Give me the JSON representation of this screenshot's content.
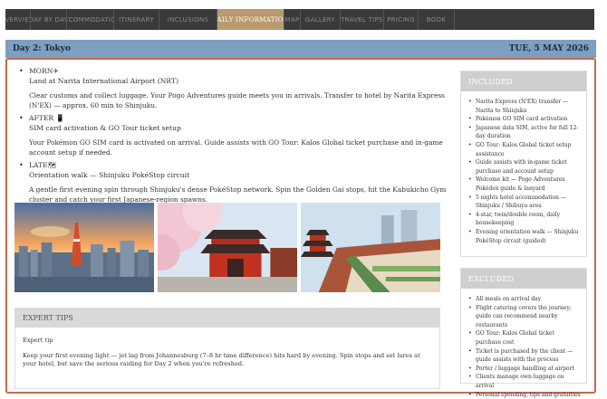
{
  "nav": {
    "tabs": [
      {
        "label": "OVERVIEW",
        "active": false
      },
      {
        "label": "DAY BY DAY",
        "active": false
      },
      {
        "label": "ACCOMMODATION",
        "active": false
      },
      {
        "label": "ITINERARY",
        "active": false
      },
      {
        "label": "INCLUSIONS",
        "active": false
      },
      {
        "label": "DAILY INFORMATION",
        "active": true
      },
      {
        "label": "MAP",
        "active": false
      },
      {
        "label": "GALLERY",
        "active": false
      },
      {
        "label": "TRAVEL TIPS",
        "active": false
      },
      {
        "label": "PRICING",
        "active": false
      },
      {
        "label": "BOOK",
        "active": false
      }
    ]
  },
  "day": {
    "title": "Day 2: Tokyo",
    "date": "TUE, 5 MAY 2026"
  },
  "schedule": [
    {
      "slot": "MORN✈",
      "title": "Land at Narita International Airport (NRT)",
      "description": "Clear customs and collect luggage. Your Pogo Adventures guide meets you in arrivals. Transfer to hotel by Narita Express (N'EX) — approx. 60 min to Shinjuku."
    },
    {
      "slot": "AFTER 📱",
      "title": "SIM card activation & GO Tour ticket setup",
      "description": "Your Pokémon GO SIM card is activated on arrival. Guide assists with GO Tour: Kalos Global ticket purchase and in-game account setup if needed."
    },
    {
      "slot": "LATE🗺",
      "title": "Orientation walk — Shinjuku PokéStop circuit",
      "description": "A gentle first evening spin through Shinjuku's dense PokéStop network. Spin the Golden Gai stops, hit the Kabukicho Gym cluster and catch your first Japanese-region spawns."
    }
  ],
  "expert_tips": {
    "header": "EXPERT TIPS",
    "subtitle": "Expert tip",
    "text": "Keep your first evening light — jet lag from Johannesburg (7–8 hr time difference) hits hard by evening. Spin stops and set lures at your hotel, but save the serious raiding for Day 2 when you're refreshed."
  },
  "included": {
    "header": "INCLUDED",
    "items": [
      "Narita Express (N'EX) transfer — Narita to Shinjuku",
      "Pokémon GO SIM card activation",
      "Japanese data SIM, active for full 12-day duration",
      "GO Tour: Kalos Global ticket setup assistance",
      "Guide assists with in-game ticket purchase and account setup",
      "Welcome kit — Pogo Adventures Pokédex guide & lanyard",
      "5 nights hotel accommodation — Shinjuku / Shibuya area",
      "4-star, twin/double room, daily housekeeping",
      "Evening orientation walk — Shinjuku PokéStop circuit (guided)"
    ]
  },
  "excluded": {
    "header": "EXCLUDED",
    "items": [
      "All meals on arrival day",
      "Flight catering covers the journey; guide can recommend nearby restaurants",
      "GO Tour: Kalos Global ticket purchase cost",
      "Ticket is purchased by the client — guide assists with the process",
      "Porter / luggage handling at airport",
      "Clients manage own luggage on arrival",
      "Personal spending, tips and gratuities"
    ]
  },
  "photos": [
    {
      "name": "tokyo-skyline-sunset-photo"
    },
    {
      "name": "sensoji-temple-cherry-blossom-photo"
    },
    {
      "name": "nakamise-street-pagoda-photo"
    }
  ]
}
